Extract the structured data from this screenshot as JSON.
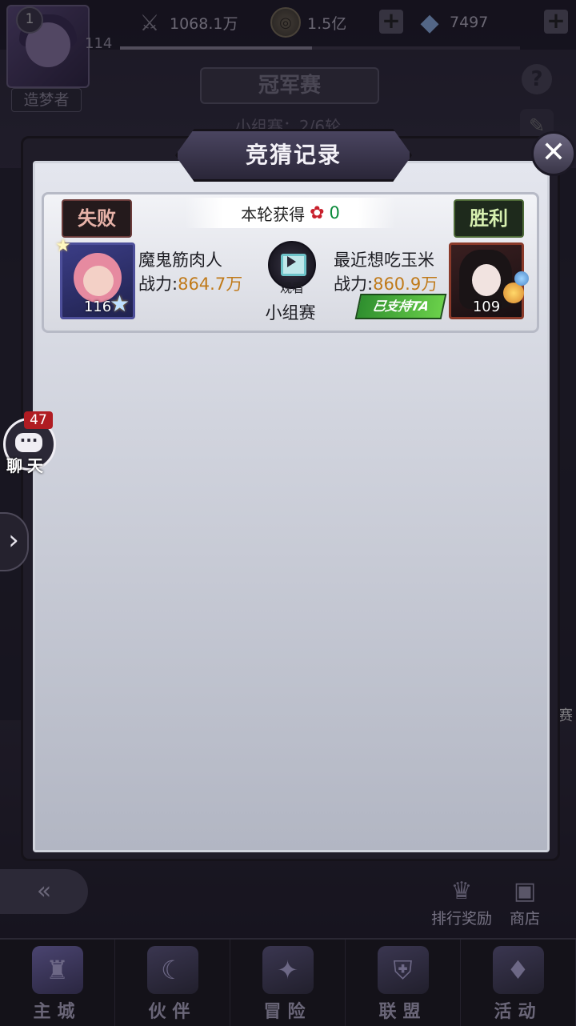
{
  "top_bar": {
    "vip_level": "1",
    "player_level": "114",
    "player_name": "造梦者",
    "power": "1068.1万",
    "gold": "1.5亿",
    "gems": "7497",
    "progress_fraction": 0.48
  },
  "page": {
    "title": "冠军赛",
    "subtitle": "小组赛：2/6轮"
  },
  "modal": {
    "title": "竞猜记录",
    "record": {
      "earn_label": "本轮获得",
      "earn_value": "0",
      "left": {
        "result": "失败",
        "name": "魔鬼筋肉人",
        "power_label": "战力:",
        "power_value": "864.7万",
        "level": "116"
      },
      "right": {
        "result": "胜利",
        "name": "最近想吃玉米",
        "power_label": "战力:",
        "power_value": "860.9万",
        "level": "109",
        "supported_tag": "已支持TA"
      },
      "watch_label": "观看",
      "stage": "小组赛"
    }
  },
  "chat": {
    "count": "47",
    "label": "聊天"
  },
  "bottom": {
    "rank_reward": "排行奖励",
    "shop": "商店",
    "right_edge_text": "赛",
    "nav": [
      {
        "label": "主城",
        "icon": "castle-icon"
      },
      {
        "label": "伙伴",
        "icon": "partner-icon"
      },
      {
        "label": "冒险",
        "icon": "adventure-icon"
      },
      {
        "label": "联盟",
        "icon": "alliance-icon"
      },
      {
        "label": "活动",
        "icon": "event-icon"
      }
    ]
  }
}
